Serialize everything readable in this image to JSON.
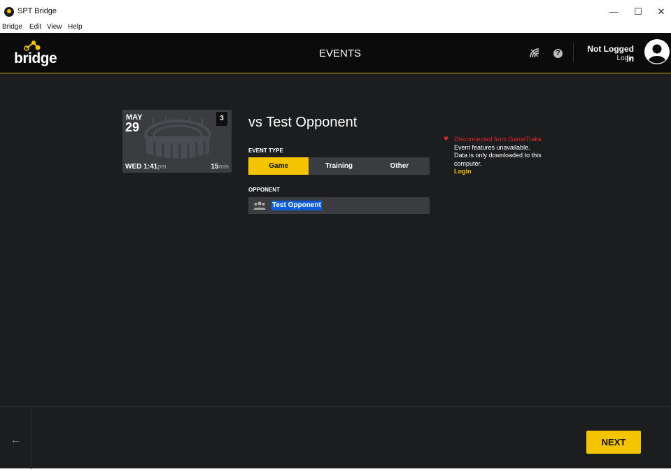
{
  "window": {
    "title": "SPT Bridge",
    "minimize": "—",
    "maximize": "☐",
    "close": "✕"
  },
  "menu": [
    "Bridge",
    "Edit",
    "View",
    "Help"
  ],
  "header": {
    "logo_text": "bridge",
    "title": "EVENTS",
    "user_name": "Not Logged In",
    "user_login": "Login"
  },
  "event_card": {
    "month": "MAY",
    "day": "29",
    "count": "3",
    "weekday_time": "WED 1:41",
    "ampm": "pm",
    "duration": "15",
    "duration_unit": "min"
  },
  "event": {
    "title": "vs Test Opponent",
    "event_type_label": "EVENT TYPE",
    "types": [
      "Game",
      "Training",
      "Other"
    ],
    "selected_type": "Game",
    "opponent_label": "OPPONENT",
    "opponent_value": "Test Opponent"
  },
  "status": {
    "error": "Disconnected from GameTraka",
    "line1": "Event features unavailable.",
    "line2": "Data is only downloaded to this",
    "line3": "computer.",
    "login_link": "Login"
  },
  "footer": {
    "back_icon": "arrow-left-icon",
    "next_label": "NEXT"
  },
  "colors": {
    "accent": "#f5c400",
    "background": "#1c1d1f",
    "header": "#0b0b0b",
    "error": "#e0252b",
    "selection": "#0b5ed7"
  }
}
